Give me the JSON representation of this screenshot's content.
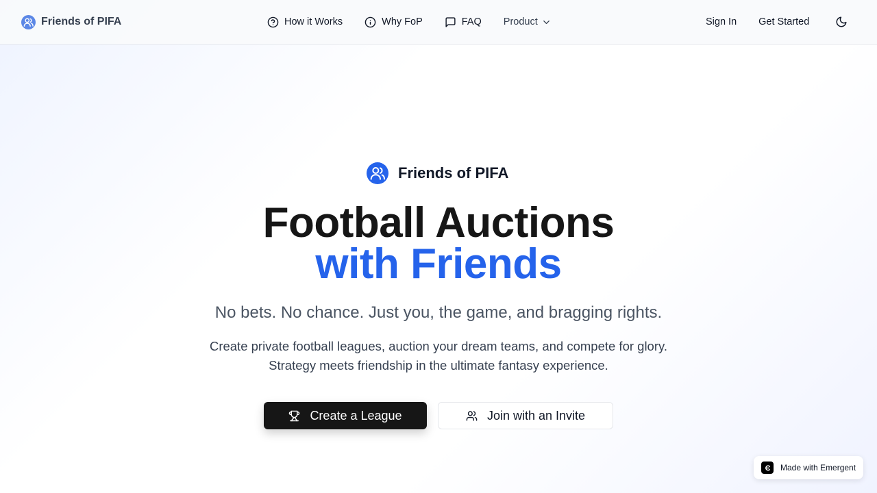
{
  "nav": {
    "brand": "Friends of PIFA",
    "links": [
      {
        "label": "How it Works",
        "icon": "help-circle-icon"
      },
      {
        "label": "Why FoP",
        "icon": "info-circle-icon"
      },
      {
        "label": "FAQ",
        "icon": "message-square-icon"
      }
    ],
    "product": "Product",
    "sign_in": "Sign In",
    "get_started": "Get Started",
    "theme_icon": "moon-icon"
  },
  "hero": {
    "brand": "Friends of PIFA",
    "headline_line1": "Football Auctions",
    "headline_line2": "with Friends",
    "tagline": "No bets. No chance. Just you, the game, and bragging rights.",
    "description": "Create private football leagues, auction your dream teams, and compete for glory. Strategy meets friendship in the ultimate fantasy experience.",
    "primary_button": "Create a League",
    "secondary_button": "Join with an Invite"
  },
  "badge": {
    "label": "Made with Emergent"
  },
  "colors": {
    "accent": "#2563eb",
    "dark": "#161616",
    "logo_light": "#5b87e6"
  }
}
